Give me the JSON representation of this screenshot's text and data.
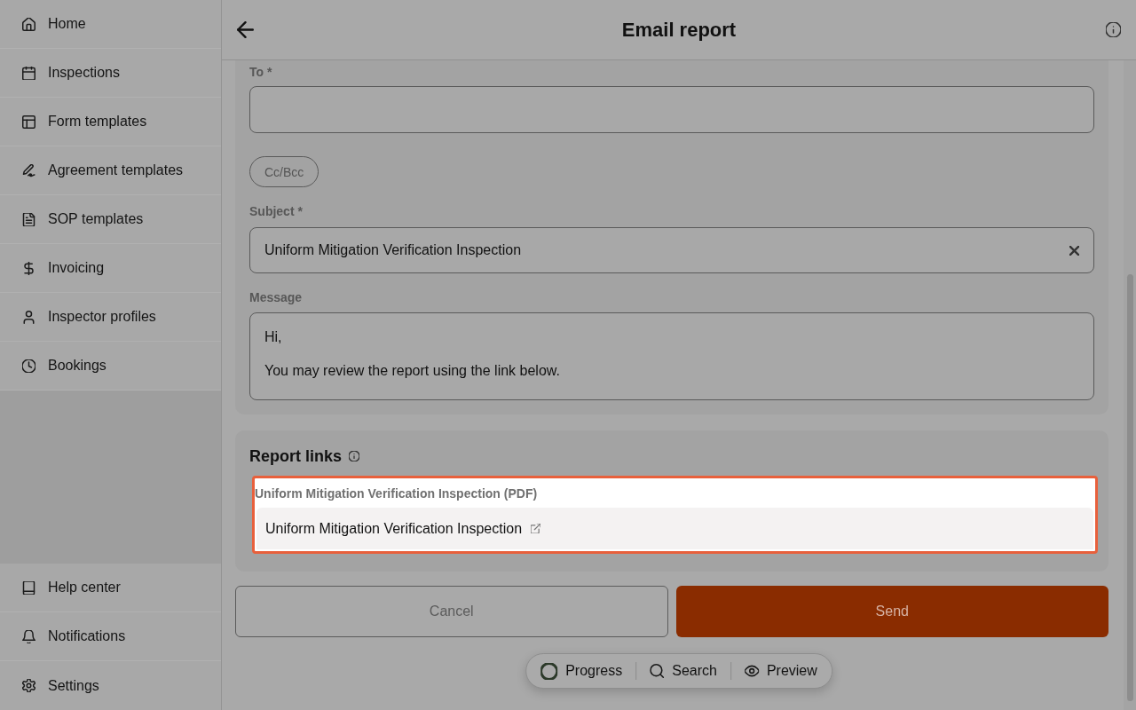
{
  "header": {
    "title": "Email report"
  },
  "sidebar": {
    "items": [
      {
        "label": "Home",
        "selected": false
      },
      {
        "label": "Inspections",
        "selected": false
      },
      {
        "label": "Form templates",
        "selected": false
      },
      {
        "label": "Agreement templates",
        "selected": false
      },
      {
        "label": "SOP templates",
        "selected": false
      },
      {
        "label": "Invoicing",
        "selected": false
      },
      {
        "label": "Inspector profiles",
        "selected": false
      },
      {
        "label": "Bookings",
        "selected": false
      }
    ],
    "footer_items": [
      {
        "label": "Help center",
        "selected": false
      },
      {
        "label": "Notifications",
        "selected": false
      },
      {
        "label": "Settings",
        "selected": false
      }
    ]
  },
  "form": {
    "to": {
      "label": "To *"
    },
    "cc_bcc_button": "Cc/Bcc",
    "subject": {
      "label": "Subject *",
      "value": "Uniform Mitigation Verification Inspection"
    },
    "message": {
      "label": "Message",
      "value": "Hi,\n\nYou may review the report using the link below."
    }
  },
  "report_links": {
    "title": "Report links",
    "items": [
      {
        "label": "Uniform Mitigation Verification Inspection (PDF)",
        "link": "Uniform Mitigation Verification Inspection",
        "highlighted": true
      }
    ]
  },
  "actions": [
    {
      "label": "Cancel",
      "kind": "secondary"
    },
    {
      "label": "Send",
      "kind": "primary"
    }
  ],
  "floating_toolbar": {
    "items": [
      {
        "label": "Progress"
      },
      {
        "label": "Search"
      },
      {
        "label": "Preview"
      }
    ]
  }
}
